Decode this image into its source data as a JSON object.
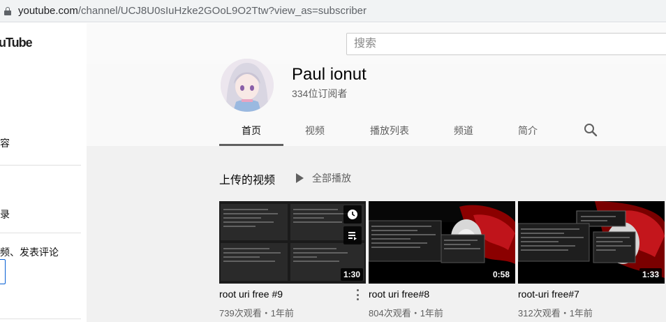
{
  "browser": {
    "url_host": "youtube.com",
    "url_path": "/channel/UCJ8U0sIuHzke2GOoL9O2Ttw?view_as=subscriber"
  },
  "sidebar": {
    "logo": "uTube",
    "items": [
      {
        "label": "容"
      },
      {
        "label": "录"
      },
      {
        "label": "频、发表评论"
      }
    ]
  },
  "masthead": {
    "search_placeholder": "搜索"
  },
  "channel": {
    "name": "Paul ionut",
    "subscribers": "334位订阅者"
  },
  "tabs": [
    {
      "label": "首页",
      "active": true
    },
    {
      "label": "视频",
      "active": false
    },
    {
      "label": "播放列表",
      "active": false
    },
    {
      "label": "频道",
      "active": false
    },
    {
      "label": "简介",
      "active": false
    }
  ],
  "section": {
    "title": "上传的视频",
    "play_all": "全部播放"
  },
  "videos": [
    {
      "title": "root uri free #9",
      "meta": "739次观看・1年前",
      "duration": "1:30"
    },
    {
      "title": "root uri free#8",
      "meta": "804次观看・1年前",
      "duration": "0:58"
    },
    {
      "title": "root-uri free#7",
      "meta": "312次观看・1年前",
      "duration": "1:33"
    }
  ],
  "icons": {
    "lock": "lock-icon",
    "search": "search-icon",
    "play": "play-icon",
    "clock": "watch-later-icon",
    "queue": "add-to-queue-icon",
    "more": "more-vert-icon"
  },
  "colors": {
    "accent": "#065fd4",
    "thumb_red": "#b00000"
  }
}
